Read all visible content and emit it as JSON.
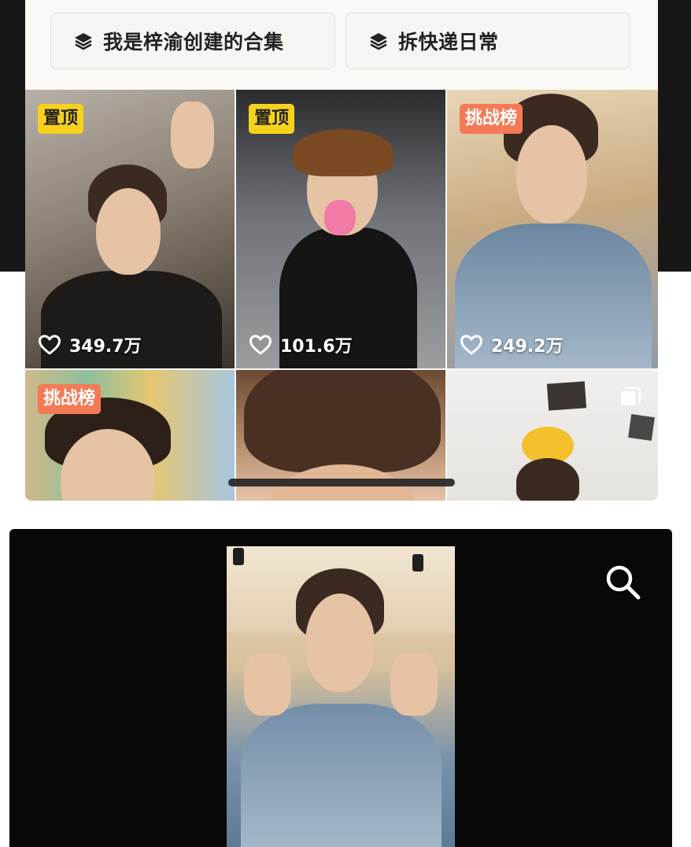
{
  "collections": [
    {
      "label": "我是梓渝创建的合集",
      "icon": "layers-icon"
    },
    {
      "label": "拆快递日常",
      "icon": "layers-icon"
    }
  ],
  "videos": [
    {
      "badge": "置顶",
      "badge_type": "pinned",
      "likes": "349.7万"
    },
    {
      "badge": "置顶",
      "badge_type": "pinned",
      "likes": "101.6万"
    },
    {
      "badge": "挑战榜",
      "badge_type": "challenge",
      "likes": "249.2万"
    },
    {
      "badge": "挑战榜",
      "badge_type": "challenge"
    },
    {},
    {
      "icon": "multi-image-icon"
    }
  ],
  "player": {
    "icon": "search-icon"
  },
  "colors": {
    "pinned_badge": "#f7d21d",
    "challenge_badge": "#f47a56",
    "player_bg": "#080808",
    "panel_bg": "#faf9f6"
  }
}
